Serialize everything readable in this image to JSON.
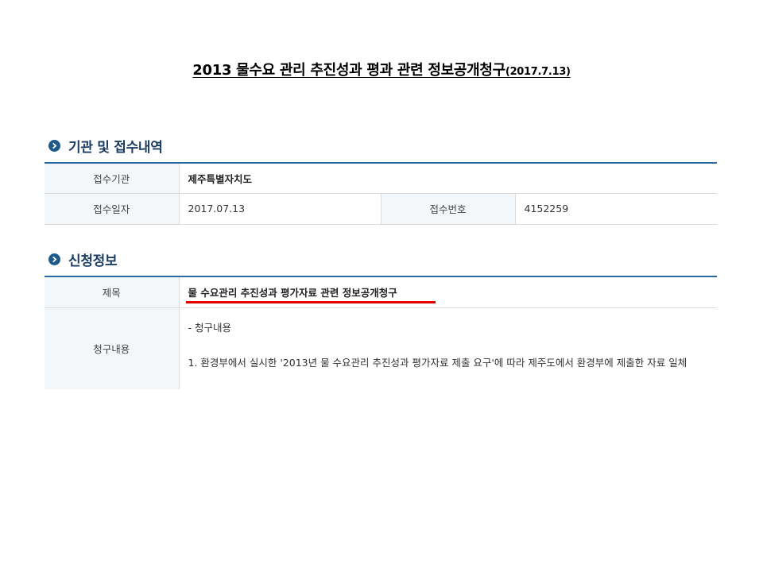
{
  "document": {
    "title": "2013 물수요 관리 추진성과 평과 관련 정보공개청구",
    "title_date": "(2017.7.13)"
  },
  "section1": {
    "heading": "기관 및 접수내역",
    "rows": {
      "agency_label": "접수기관",
      "agency_value": "제주특별자치도",
      "date_label": "접수일자",
      "date_value": "2017.07.13",
      "number_label": "접수번호",
      "number_value": "4152259"
    }
  },
  "section2": {
    "heading": "신청정보",
    "subject_label": "제목",
    "subject_value": "물 수요관리 추진성과 평가자료 관련 정보공개청구",
    "content_label": "청구내용",
    "content_line1": "- 청구내용",
    "content_line2": "1. 환경부에서 실시한 '2013년 물 수요관리 추진성과 평가자료 제출 요구'에 따라 제주도에서 환경부에 제출한 자료 일체"
  },
  "colors": {
    "accent_blue": "#2b6aa3",
    "heading_blue": "#1c3d63",
    "highlight_red": "#e00000",
    "header_cell_bg": "#f4f7fa"
  },
  "icons": {
    "section_bullet": "chevron-right-circle-icon"
  }
}
